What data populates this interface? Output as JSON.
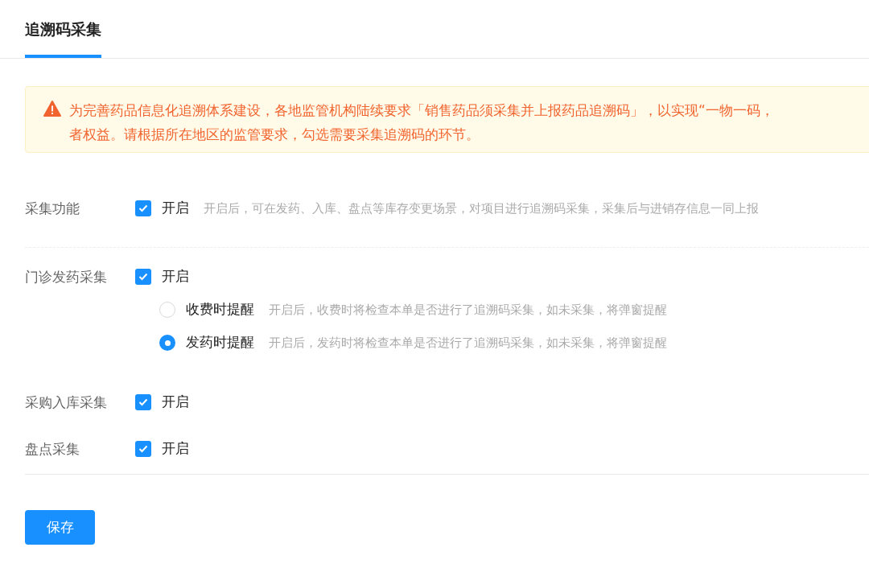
{
  "tabs": [
    {
      "label": "追溯码采集",
      "selected": true
    }
  ],
  "alert": {
    "lines": [
      "为完善药品信息化追溯体系建设，各地监管机构陆续要求「销售药品须采集并上报药品追溯码」，以实现“一物一码，",
      "者权益。请根据所在地区的监管要求，勾选需要采集追溯码的环节。"
    ]
  },
  "sections": [
    {
      "settings": [
        {
          "label": "采集功能",
          "checked": true,
          "option": "开启",
          "hint": "开启后，可在发药、入库、盘点等库存变更场景，对项目进行追溯码采集，采集后与进销存信息一同上报"
        }
      ]
    },
    {
      "settings": [
        {
          "label": "门诊发药采集",
          "checked": true,
          "option": "开启",
          "radios": [
            {
              "label": "收费时提醒",
              "selected": false,
              "hint": "开启后，收费时将检查本单是否进行了追溯码采集，如未采集，将弹窗提醒"
            },
            {
              "label": "发药时提醒",
              "selected": true,
              "hint": "开启后，发药时将检查本单是否进行了追溯码采集，如未采集，将弹窗提醒"
            }
          ]
        },
        {
          "label": "采购入库采集",
          "checked": true,
          "option": "开启"
        },
        {
          "label": "盘点采集",
          "checked": true,
          "option": "开启"
        }
      ]
    }
  ],
  "save_button": "保存"
}
